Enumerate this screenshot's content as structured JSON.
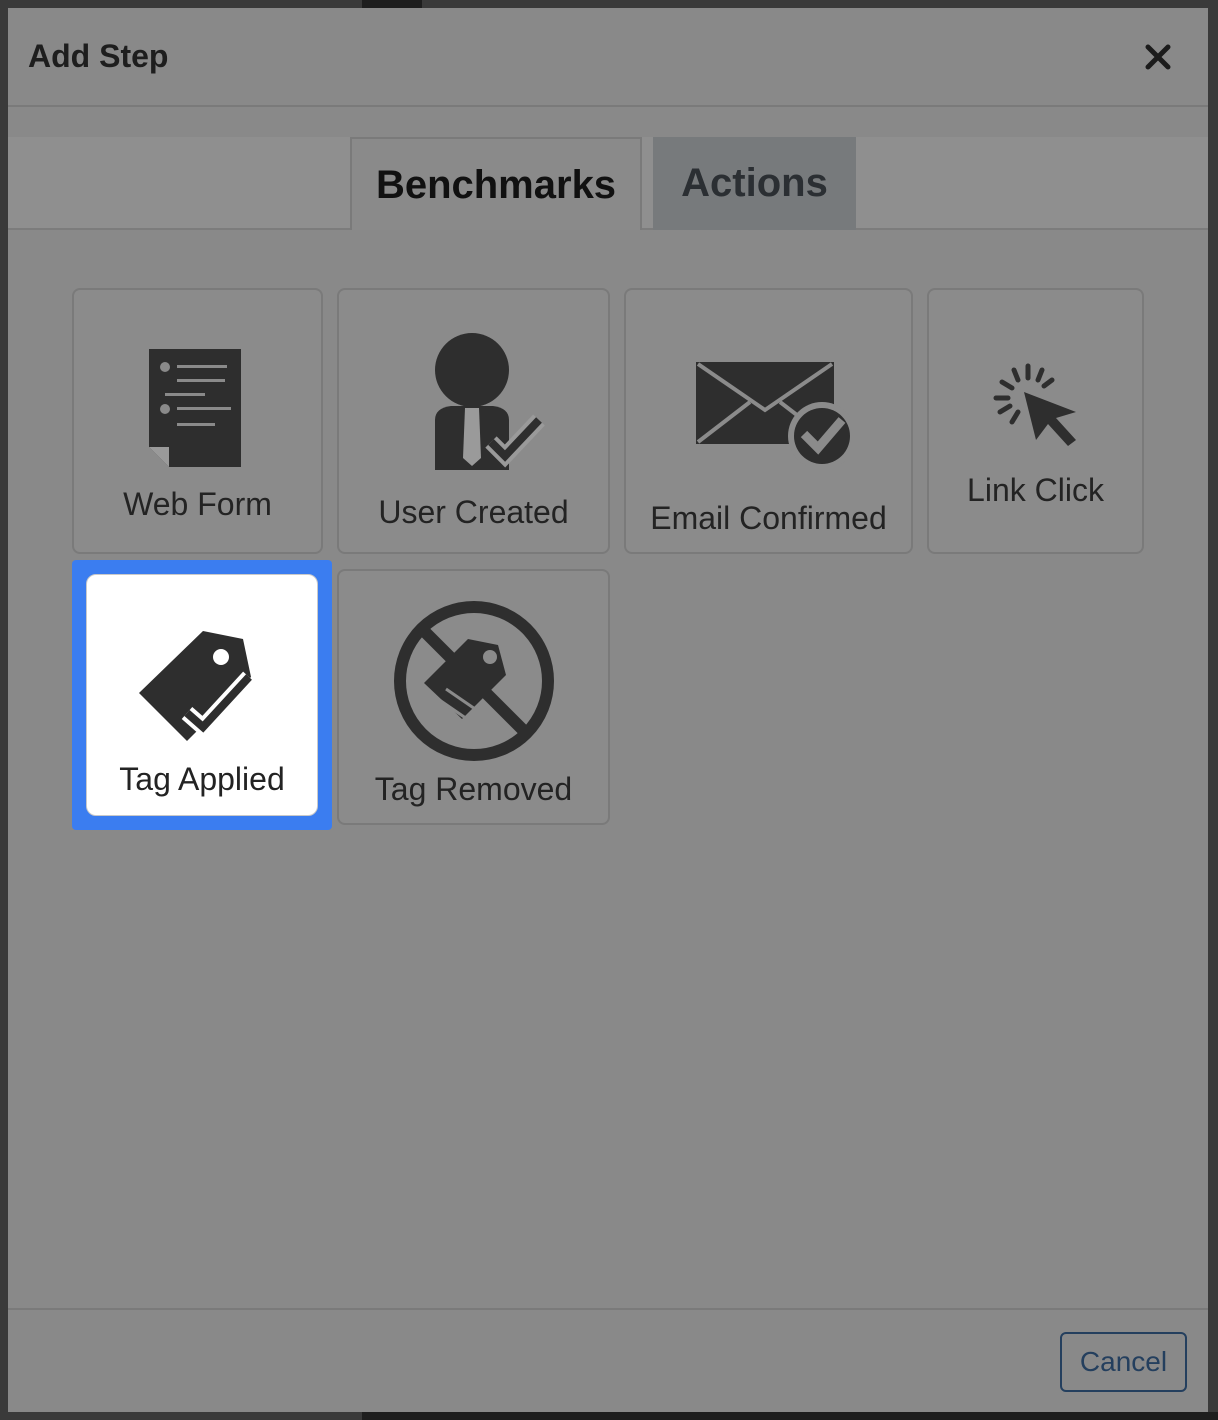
{
  "modal": {
    "title": "Add Step",
    "close_icon": "close-icon"
  },
  "tabs": [
    {
      "label": "Benchmarks",
      "active": true
    },
    {
      "label": "Actions",
      "active": false
    }
  ],
  "steps": [
    {
      "label": "Web Form",
      "icon": "document-icon",
      "selected": false
    },
    {
      "label": "User Created",
      "icon": "user-check-icon",
      "selected": false
    },
    {
      "label": "Email Confirmed",
      "icon": "envelope-check-icon",
      "selected": false
    },
    {
      "label": "Link Click",
      "icon": "cursor-click-icon",
      "selected": false
    },
    {
      "label": "Tag Applied",
      "icon": "tag-check-icon",
      "selected": true
    },
    {
      "label": "Tag Removed",
      "icon": "tag-removed-icon",
      "selected": false
    }
  ],
  "footer": {
    "cancel_label": "Cancel"
  },
  "colors": {
    "overlay": "#898989",
    "selection_ring": "#3b7df0",
    "icon": "#2e2e2e",
    "cancel_text": "#243f5e"
  }
}
